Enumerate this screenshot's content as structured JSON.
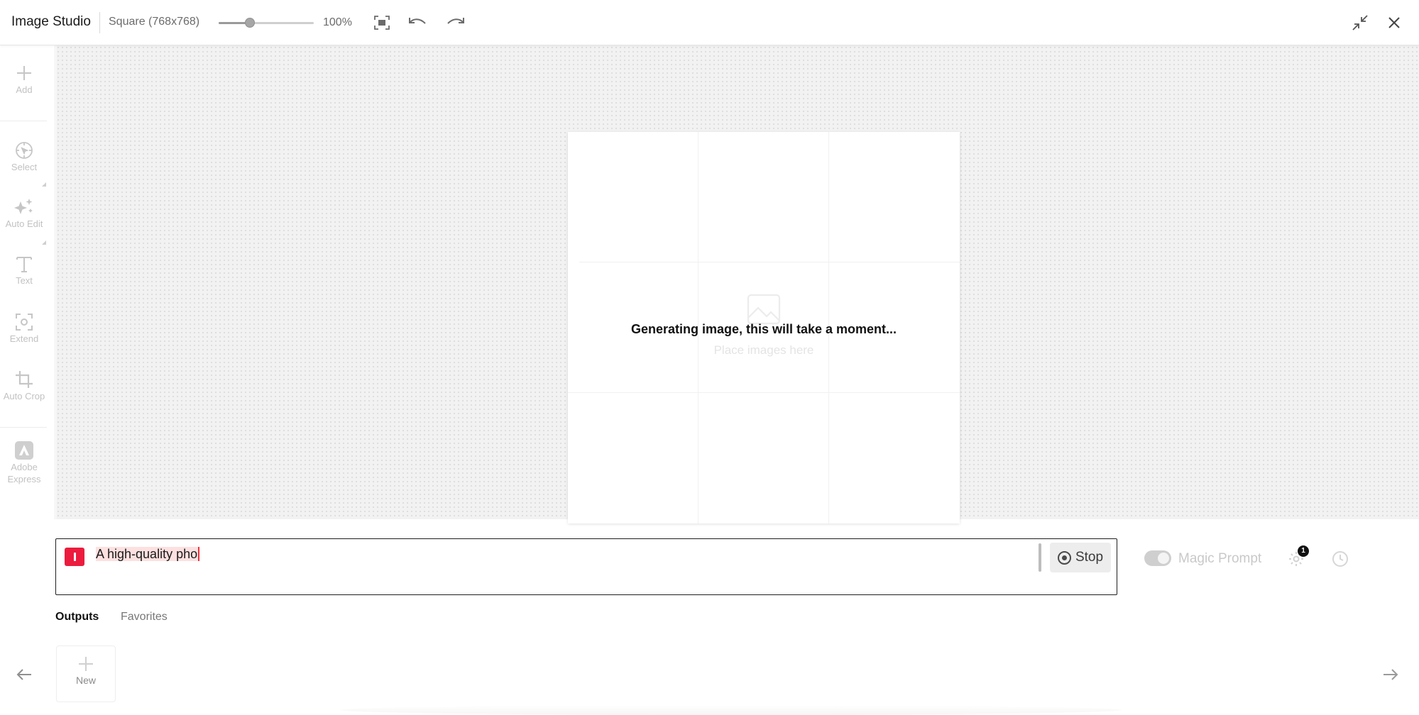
{
  "header": {
    "app_title": "Image Studio",
    "canvas_size": "Square (768x768)",
    "zoom_label": "100%",
    "zoom_level_fraction": 0.33,
    "icons": [
      "fit-screen-icon",
      "undo-icon",
      "redo-icon",
      "minimize-icon",
      "close-icon"
    ]
  },
  "sidebar": {
    "items": [
      {
        "label": "Add",
        "icon": "plus-icon"
      },
      {
        "label": "Select",
        "icon": "select-icon"
      },
      {
        "label": "Auto Edit",
        "icon": "sparkle-icon"
      },
      {
        "label": "Text",
        "icon": "text-icon"
      },
      {
        "label": "Extend",
        "icon": "extend-icon"
      },
      {
        "label": "Auto Crop",
        "icon": "crop-icon"
      },
      {
        "label": "Adobe Express",
        "icon": "adobe-express-icon"
      }
    ]
  },
  "canvas": {
    "placeholder_text": "Place images here",
    "status_text": "Generating image, this will take a moment..."
  },
  "prompt": {
    "text": "A high-quality pho",
    "stop_label": "Stop",
    "magic_prompt_label": "Magic Prompt",
    "settings_badge_count": "1"
  },
  "tabs": {
    "outputs": "Outputs",
    "favorites": "Favorites"
  },
  "outputs": {
    "new_label": "New"
  },
  "colors": {
    "accent": "#ec1c3e",
    "canvas_bg": "#f2f2f2",
    "text_primary": "#1a1a1a"
  }
}
